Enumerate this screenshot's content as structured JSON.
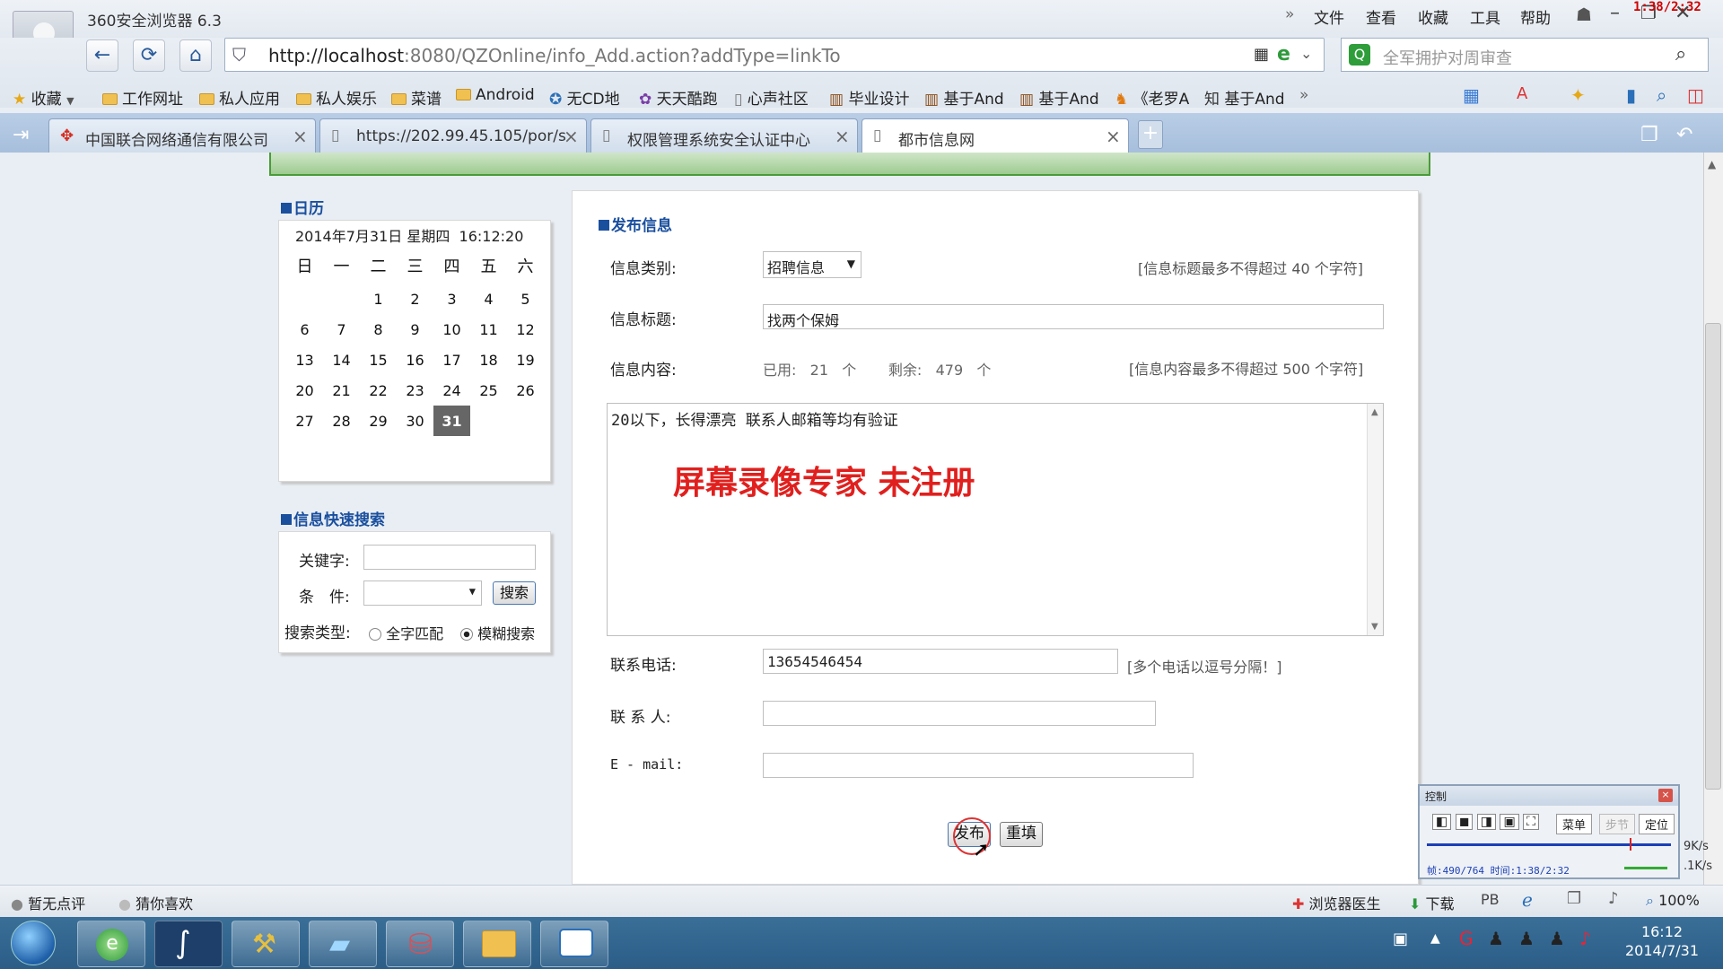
{
  "browser": {
    "app_name": "360安全浏览器 6.3",
    "menu": [
      "文件",
      "查看",
      "收藏",
      "工具",
      "帮助"
    ],
    "menu_more": "»",
    "url_host": "http://localhost",
    "url_rest": ":8080/QZOnline/info_Add.action?addType=linkTo",
    "search_placeholder": "全军拥护对周审查",
    "recording_timer": "1:38/2:32",
    "bookmarks": [
      "收藏",
      "工作网址",
      "私人应用",
      "私人娱乐",
      "菜谱",
      "Android",
      "无CD地",
      "天天酷跑",
      "心声社区",
      "毕业设计",
      "基于And",
      "基于And",
      "《老罗A",
      "基于And"
    ],
    "bookmarks_more": "»",
    "tabs": [
      {
        "title": "中国联合网络通信有限公司",
        "active": false
      },
      {
        "title": "https://202.99.45.105/por/s",
        "active": false
      },
      {
        "title": "权限管理系统安全认证中心",
        "active": false
      },
      {
        "title": "都市信息网",
        "active": true
      }
    ],
    "new_tab": "+"
  },
  "calendar": {
    "heading": "日历",
    "datetime_date": "2014年7月31日 星期四",
    "datetime_time": "16:12:20",
    "weekdays": [
      "日",
      "一",
      "二",
      "三",
      "四",
      "五",
      "六"
    ],
    "weeks": [
      [
        "",
        "",
        "1",
        "2",
        "3",
        "4",
        "5"
      ],
      [
        "6",
        "7",
        "8",
        "9",
        "10",
        "11",
        "12"
      ],
      [
        "13",
        "14",
        "15",
        "16",
        "17",
        "18",
        "19"
      ],
      [
        "20",
        "21",
        "22",
        "23",
        "24",
        "25",
        "26"
      ],
      [
        "27",
        "28",
        "29",
        "30",
        "31",
        "",
        ""
      ]
    ],
    "today": "31"
  },
  "quicksearch": {
    "heading": "信息快速搜索",
    "keyword_label": "关键字:",
    "condition_label": "条　件:",
    "search_button": "搜索",
    "type_label": "搜索类型:",
    "options": [
      "全字匹配",
      "模糊搜索"
    ],
    "selected": "模糊搜索"
  },
  "publish": {
    "heading": "发布信息",
    "category_label": "信息类别:",
    "category_value": "招聘信息",
    "title_hint": "[信息标题最多不得超过 40 个字符]",
    "title_label": "信息标题:",
    "title_value": "找两个保姆",
    "content_label": "信息内容:",
    "used_label": "已用:",
    "used_count": "21",
    "unit": "个",
    "remain_label": "剩余:",
    "remain_count": "479",
    "content_hint": "[信息内容最多不得超过 500 个字符]",
    "content_value": "20以下，长得漂亮 联系人邮箱等均有验证",
    "watermark": "屏幕录像专家 未注册",
    "phone_label": "联系电话:",
    "phone_value": "13654546454",
    "phone_hint": "[多个电话以逗号分隔！]",
    "contact_label": "联 系 人:",
    "email_label": "E - mail:",
    "submit_button": "发布",
    "reset_button": "重填"
  },
  "statusbar": {
    "left": [
      "暂无点评",
      "猜你喜欢"
    ],
    "doctor": "浏览器医生",
    "download": "下载",
    "zoom": "100%",
    "speed1": "9K/s",
    "speed2": ".1K/s"
  },
  "recorder": {
    "title": "控制",
    "menu_btn": "菜单",
    "step_btn": "步节",
    "locate_btn": "定位",
    "progress": 0.83,
    "status": "帧:490/764 时间:1:38/2:32"
  },
  "taskbar": {
    "time": "16:12",
    "date": "2014/7/31"
  },
  "colors": {
    "link_blue": "#1a4f9e",
    "watermark_red": "#e0201e",
    "banner_green": "#4a9b3a"
  }
}
